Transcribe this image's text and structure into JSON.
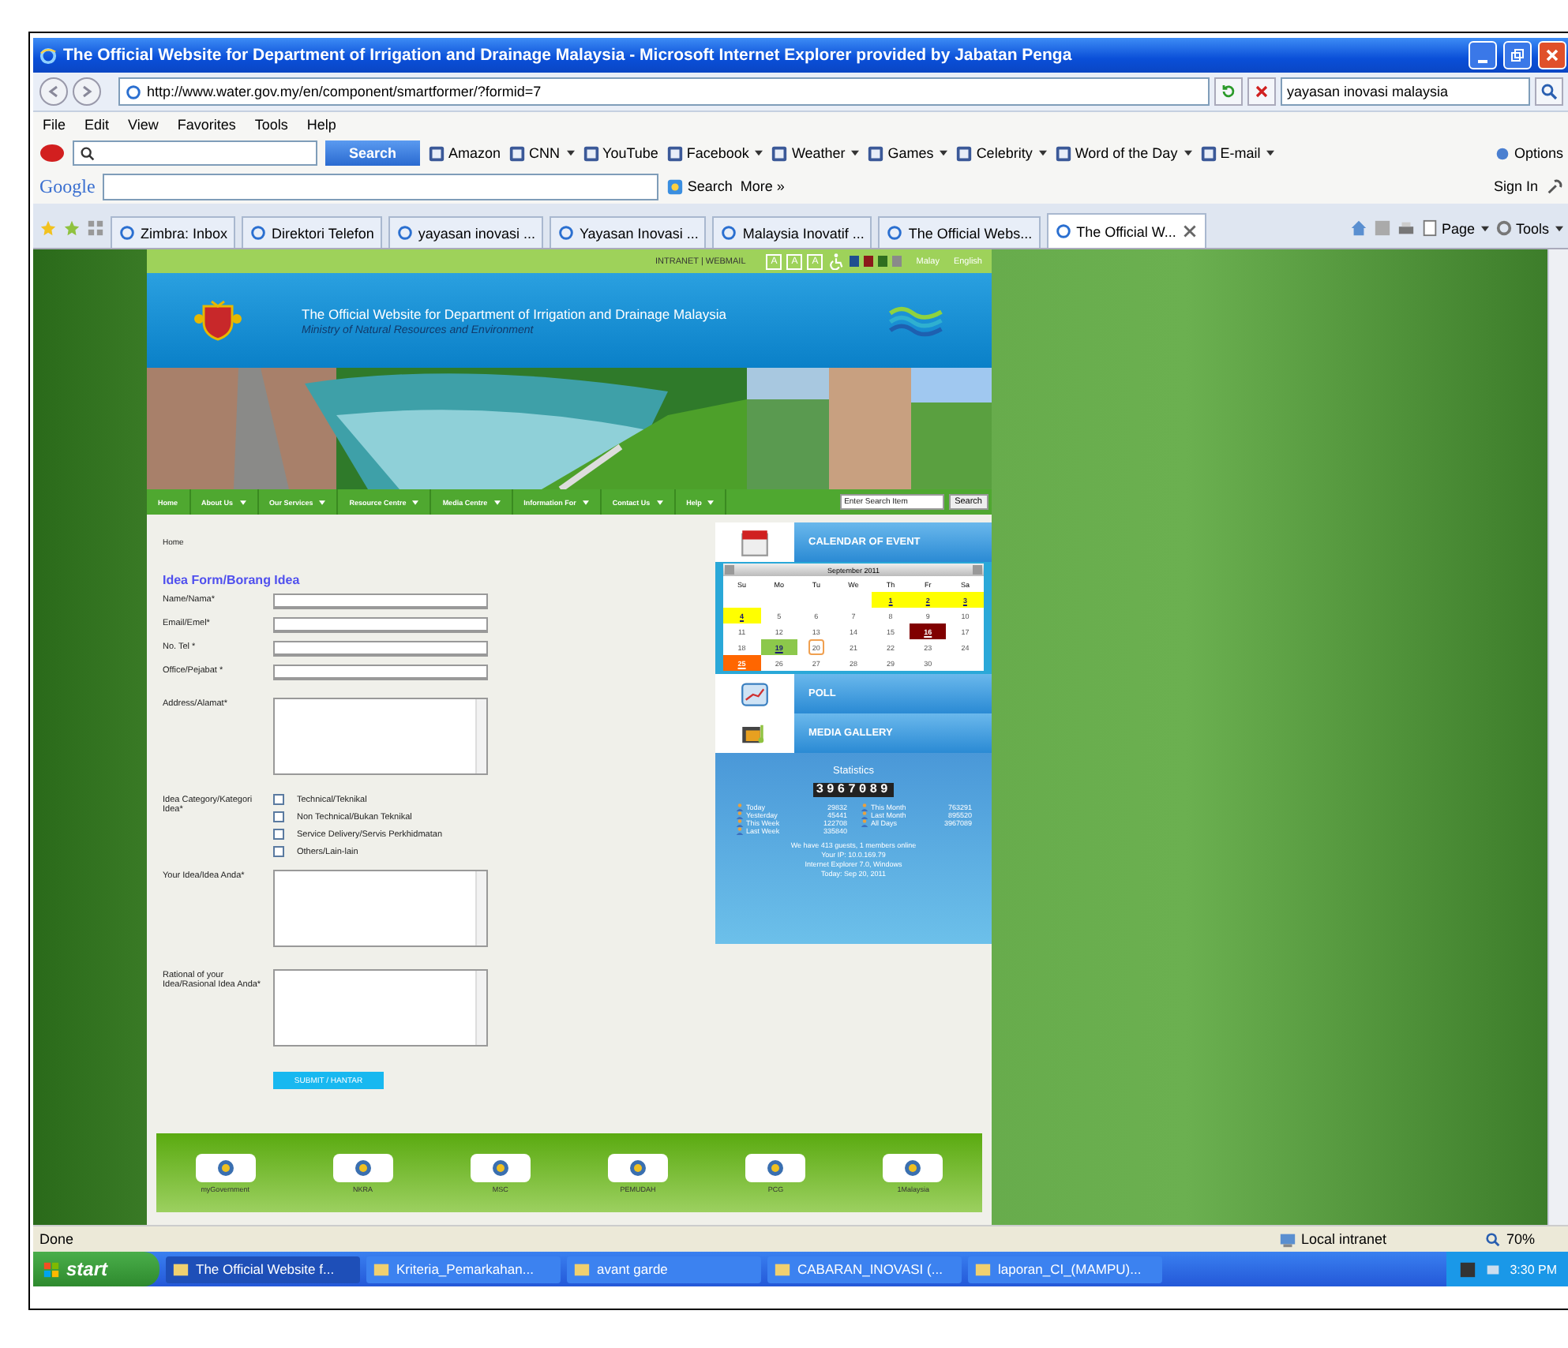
{
  "window": {
    "title": "The Official Website for Department of Irrigation and Drainage Malaysia - Microsoft Internet Explorer provided by Jabatan Penga"
  },
  "address_bar": {
    "url": "http://www.water.gov.my/en/component/smartformer/?formid=7"
  },
  "search_box": {
    "value": "yayasan inovasi malaysia"
  },
  "menu": [
    "File",
    "Edit",
    "View",
    "Favorites",
    "Tools",
    "Help"
  ],
  "ask_toolbar": {
    "button": "Search",
    "options": "Options",
    "links": [
      {
        "label": "Amazon",
        "dropdown": false
      },
      {
        "label": "CNN",
        "dropdown": true
      },
      {
        "label": "YouTube",
        "dropdown": false
      },
      {
        "label": "Facebook",
        "dropdown": true
      },
      {
        "label": "Weather",
        "dropdown": true
      },
      {
        "label": "Games",
        "dropdown": true
      },
      {
        "label": "Celebrity",
        "dropdown": true
      },
      {
        "label": "Word of the Day",
        "dropdown": true
      },
      {
        "label": "E-mail",
        "dropdown": true
      }
    ]
  },
  "google_toolbar": {
    "logo": "Google",
    "search": "Search",
    "more": "More »",
    "sign_in": "Sign In"
  },
  "tabs": [
    {
      "label": "Zimbra: Inbox",
      "selected": false
    },
    {
      "label": "Direktori Telefon",
      "selected": false
    },
    {
      "label": "yayasan inovasi ...",
      "selected": false
    },
    {
      "label": "Yayasan Inovasi ...",
      "selected": false
    },
    {
      "label": "Malaysia Inovatif ...",
      "selected": false
    },
    {
      "label": "The Official Webs...",
      "selected": false
    },
    {
      "label": "The Official W...",
      "selected": true
    }
  ],
  "command_bar": {
    "page": "Page",
    "tools": "Tools"
  },
  "page": {
    "top_links": "INTRANET | WEBMAIL",
    "text_sizes": [
      "A",
      "A",
      "A"
    ],
    "themes": [
      {
        "color": "#1f4f8f"
      },
      {
        "color": "#8b1a1a"
      },
      {
        "color": "#2f6f1f"
      },
      {
        "color": "#8a8a8a"
      }
    ],
    "languages": [
      "Malay",
      "English"
    ],
    "header": {
      "title": "The Official Website for Department of Irrigation and Drainage Malaysia",
      "subtitle": "Ministry of Natural Resources and Environment"
    },
    "nav": [
      {
        "label": "Home",
        "dropdown": false
      },
      {
        "label": "About Us",
        "dropdown": true
      },
      {
        "label": "Our Services",
        "dropdown": true
      },
      {
        "label": "Resource Centre",
        "dropdown": true
      },
      {
        "label": "Media Centre",
        "dropdown": true
      },
      {
        "label": "Information For",
        "dropdown": true
      },
      {
        "label": "Contact Us",
        "dropdown": true
      },
      {
        "label": "Help",
        "dropdown": true
      }
    ],
    "search": {
      "placeholder": "Enter Search Item",
      "button": "Search"
    },
    "breadcrumb": "Home",
    "form": {
      "title": "Idea Form/Borang Idea",
      "submit": "SUBMIT / HANTAR",
      "fields": [
        {
          "label": "Name/Nama*",
          "kind": "text"
        },
        {
          "label": "Email/Emel*",
          "kind": "text"
        },
        {
          "label": "No. Tel *",
          "kind": "text"
        },
        {
          "label": "Office/Pejabat *",
          "kind": "text"
        },
        {
          "label": "Address/Alamat*",
          "kind": "textarea"
        },
        {
          "label": "Idea Category/Kategori Idea*",
          "kind": "checkboxes",
          "options": [
            {
              "label": "Technical/Teknikal",
              "checked": false
            },
            {
              "label": "Non Technical/Bukan Teknikal",
              "checked": false
            },
            {
              "label": "Service Delivery/Servis Perkhidmatan",
              "checked": false
            },
            {
              "label": "Others/Lain-lain",
              "checked": false
            }
          ]
        },
        {
          "label": "Your Idea/Idea Anda*",
          "kind": "textarea"
        },
        {
          "label": "Rational of your Idea/Rasional Idea Anda*",
          "kind": "textarea"
        }
      ]
    },
    "sidebar": {
      "calendar": {
        "heading": "CALENDAR OF EVENT",
        "month": "September 2011",
        "weekdays": [
          "Su",
          "Mo",
          "Tu",
          "We",
          "Th",
          "Fr",
          "Sa"
        ],
        "weeks": [
          [
            {
              "kind": "blank"
            },
            {
              "kind": "blank"
            },
            {
              "kind": "blank"
            },
            {
              "kind": "blank"
            },
            {
              "kind": "day",
              "day": "1",
              "color": "#ffff00"
            },
            {
              "kind": "day",
              "day": "2",
              "color": "#ffff00"
            },
            {
              "kind": "day",
              "day": "3",
              "color": "#ffff00"
            }
          ],
          [
            {
              "kind": "day",
              "day": "4",
              "color": "#ffff00"
            },
            {
              "kind": "day",
              "day": "5"
            },
            {
              "kind": "day",
              "day": "6"
            },
            {
              "kind": "day",
              "day": "7"
            },
            {
              "kind": "day",
              "day": "8"
            },
            {
              "kind": "day",
              "day": "9"
            },
            {
              "kind": "day",
              "day": "10"
            }
          ],
          [
            {
              "kind": "day",
              "day": "11"
            },
            {
              "kind": "day",
              "day": "12"
            },
            {
              "kind": "day",
              "day": "13"
            },
            {
              "kind": "day",
              "day": "14"
            },
            {
              "kind": "day",
              "day": "15"
            },
            {
              "kind": "day",
              "day": "16",
              "color": "#800000"
            },
            {
              "kind": "day",
              "day": "17"
            }
          ],
          [
            {
              "kind": "day",
              "day": "18"
            },
            {
              "kind": "day",
              "day": "19",
              "color": "#8cc84b"
            },
            {
              "kind": "today",
              "day": "20"
            },
            {
              "kind": "day",
              "day": "21"
            },
            {
              "kind": "day",
              "day": "22"
            },
            {
              "kind": "day",
              "day": "23"
            },
            {
              "kind": "day",
              "day": "24"
            }
          ],
          [
            {
              "kind": "day",
              "day": "25",
              "color": "#ff6600"
            },
            {
              "kind": "day",
              "day": "26"
            },
            {
              "kind": "day",
              "day": "27"
            },
            {
              "kind": "day",
              "day": "28"
            },
            {
              "kind": "day",
              "day": "29"
            },
            {
              "kind": "day",
              "day": "30"
            },
            {
              "kind": "blank"
            }
          ]
        ]
      },
      "poll": "POLL",
      "media": "MEDIA GALLERY",
      "statistics": {
        "title": "Statistics",
        "counter": "3967089",
        "items": [
          {
            "label": "Today",
            "value": "29832"
          },
          {
            "label": "This Month",
            "value": "763291"
          },
          {
            "label": "Yesterday",
            "value": "45441"
          },
          {
            "label": "Last Month",
            "value": "895520"
          },
          {
            "label": "This Week",
            "value": "122708"
          },
          {
            "label": "All Days",
            "value": "3967089"
          },
          {
            "label": "Last Week",
            "value": "335840"
          }
        ],
        "lines": [
          "We have 413 guests, 1 members online",
          "Your IP: 10.0.169.79",
          "Internet Explorer 7.0, Windows",
          "Today: Sep 20, 2011"
        ]
      }
    },
    "footer_links": [
      "myGovernment",
      "NKRA",
      "MSC",
      "PEMUDAH",
      "PCG",
      "1Malaysia"
    ]
  },
  "status_bar": {
    "text": "Done",
    "zone": "Local intranet",
    "zoom": "70%"
  },
  "taskbar": {
    "start": "start",
    "clock": "3:30 PM",
    "items": [
      {
        "label": "The Official Website f...",
        "selected": true
      },
      {
        "label": "Kriteria_Pemarkahan...",
        "selected": false
      },
      {
        "label": "avant garde",
        "selected": false
      },
      {
        "label": "CABARAN_INOVASI (...",
        "selected": false
      },
      {
        "label": "laporan_CI_(MAMPU)...",
        "selected": false
      }
    ]
  }
}
